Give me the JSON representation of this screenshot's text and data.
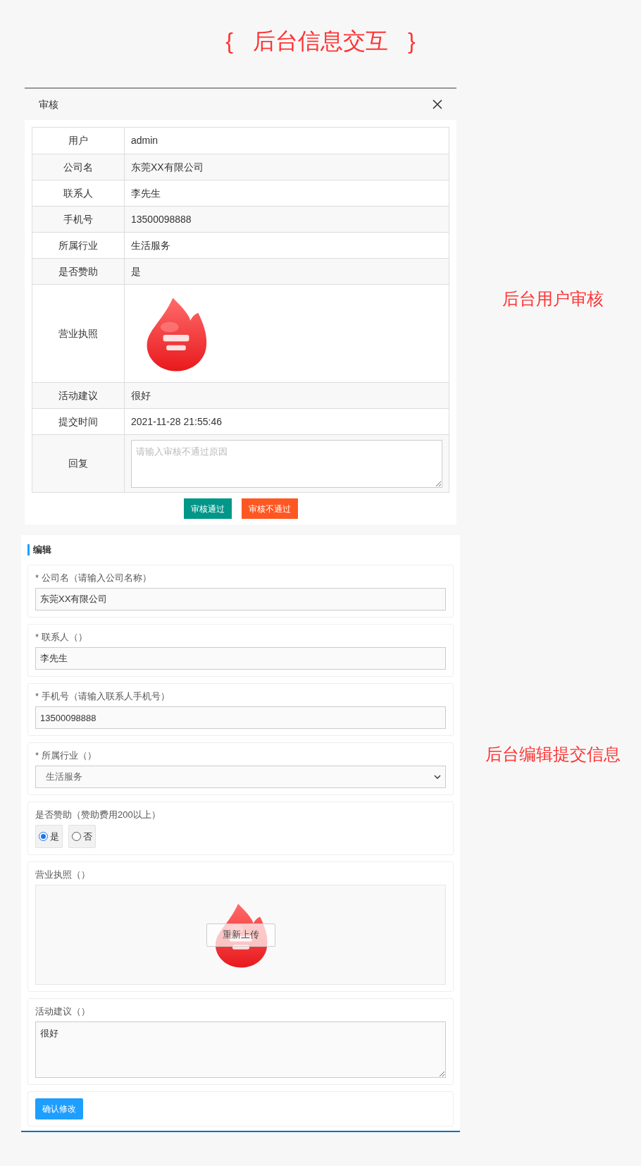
{
  "page_title": {
    "left_brace": "{",
    "text": "后台信息交互",
    "right_brace": "}"
  },
  "review_dialog": {
    "title": "审核",
    "rows": [
      {
        "kind": "text",
        "label": "用户",
        "value": "admin"
      },
      {
        "kind": "text",
        "label": "公司名",
        "value": "东莞XX有限公司"
      },
      {
        "kind": "text",
        "label": "联系人",
        "value": "李先生"
      },
      {
        "kind": "text",
        "label": "手机号",
        "value": "13500098888"
      },
      {
        "kind": "text",
        "label": "所属行业",
        "value": "生活服务"
      },
      {
        "kind": "text",
        "label": "是否赞助",
        "value": "是"
      },
      {
        "kind": "picture",
        "label": "营业执照"
      },
      {
        "kind": "text",
        "label": "活动建议",
        "value": "很好"
      },
      {
        "kind": "text",
        "label": "提交时间",
        "value": "2021-11-28 21:55:46"
      },
      {
        "kind": "textarea",
        "label": "回复",
        "placeholder": "请输入审核不通过原因"
      }
    ],
    "buttons": [
      {
        "kind": "approve",
        "label": "审核通过"
      },
      {
        "kind": "reject",
        "label": "审核不通过"
      }
    ]
  },
  "edit_form": {
    "title": "编辑",
    "fields": [
      {
        "kind": "text",
        "label": "* 公司名（请输入公司名称）",
        "value": "东莞XX有限公司"
      },
      {
        "kind": "text",
        "label": "* 联系人（）",
        "value": "李先生"
      },
      {
        "kind": "text",
        "label": "* 手机号（请输入联系人手机号）",
        "value": "13500098888"
      },
      {
        "kind": "select",
        "label": "* 所属行业（）",
        "value": "生活服务"
      },
      {
        "kind": "radio",
        "label": "是否赞助（赞助费用200以上）",
        "options": [
          {
            "label": "是",
            "selected": true
          },
          {
            "label": "否",
            "selected": false
          }
        ]
      },
      {
        "kind": "upload",
        "label": "营业执照（）",
        "button": "重新上传"
      },
      {
        "kind": "textarea",
        "label": "活动建议（）",
        "value": "很好"
      },
      {
        "kind": "submit",
        "button": "确认修改"
      }
    ]
  },
  "annotations": [
    "后台用户审核",
    "后台编辑提交信息"
  ]
}
